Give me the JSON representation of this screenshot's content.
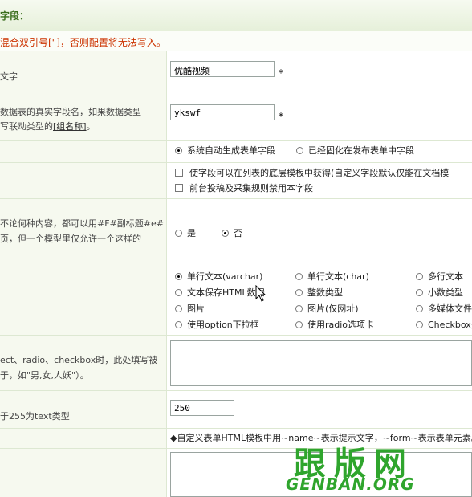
{
  "header": {
    "title": "字段："
  },
  "warning": "混合双引号[\"]，否则配置将无法写入。",
  "fields": {
    "title": {
      "label": "文字",
      "value": "优酷视频",
      "required_mark": "*"
    },
    "fieldname": {
      "label_line1": "数据表的真实字段名，如果数据类型",
      "label_line2_prefix": "写联动类型的",
      "label_line2_link": "[组名称]",
      "label_line2_suffix": "。",
      "value": "ykswf",
      "required_mark": "*"
    },
    "form_mode": {
      "options": [
        "系统自动生成表单字段",
        "已经固化在发布表单中字段"
      ],
      "selected": 0
    },
    "checkboxes": [
      "使字段可以在列表的底层模板中获得(自定义字段默认仅能在文档模",
      "前台投稿及采集规则禁用本字段"
    ],
    "special": {
      "label_line1": "不论何种内容，都可以用#F#副标题#e#",
      "label_line2": "页，但一个模型里仅允许一个这样的",
      "options": [
        "是",
        "否"
      ],
      "selected": 1
    },
    "datatype": {
      "options": [
        "单行文本(varchar)",
        "单行文本(char)",
        "多行文本",
        "文本保存HTML数据",
        "整数类型",
        "小数类型",
        "图片",
        "图片(仅网址)",
        "多媒体文件",
        "使用option下拉框",
        "使用radio选项卡",
        "Checkbox多"
      ],
      "selected": 0
    },
    "default": {
      "label_line1": "ect、radio、checkbox时，此处填写被",
      "label_line2": "于，如\"男,女,人妖\"）。"
    },
    "maxlength": {
      "label": "于255为text类型",
      "value": "250"
    },
    "template_note": "◆自定义表单HTML模板中用~name~表示提示文字，~form~表示表单元素。"
  },
  "watermark": {
    "cn": "跟版网",
    "en": "GENBAN.ORG"
  },
  "colors": {
    "label_bg": "#f6f9ef",
    "border": "#dde8d2",
    "warning": "#cc3300",
    "watermark": "#2fa52d"
  }
}
